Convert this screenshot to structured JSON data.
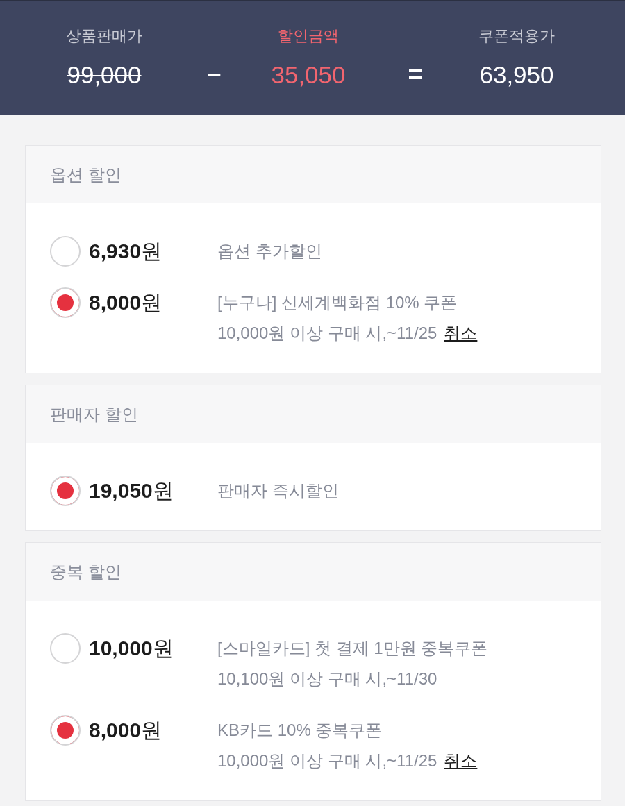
{
  "summary": {
    "original": {
      "label": "상품판매가",
      "value": "99,000"
    },
    "minus": "−",
    "discount": {
      "label": "할인금액",
      "value": "35,050"
    },
    "equals": "=",
    "final": {
      "label": "쿠폰적용가",
      "value": "63,950"
    }
  },
  "sections": [
    {
      "title": "옵션 할인",
      "options": [
        {
          "amount": "**6,930**원",
          "name": "옵션 추가할인",
          "selected": false
        },
        {
          "amount": "**8,000**원",
          "name": "[누구나] 신세계백화점 10% 쿠폰",
          "condition": "10,000원 이상 구매 시,~11/25",
          "cancel": "취소",
          "selected": true
        }
      ]
    },
    {
      "title": "판매자 할인",
      "options": [
        {
          "amount": "**19,050**원",
          "name": "판매자 즉시할인",
          "selected": true
        }
      ]
    },
    {
      "title": "중복 할인",
      "options": [
        {
          "amount": "**10,000**원",
          "name": "[스마일카드] 첫 결제 1만원 중복쿠폰",
          "condition": "10,100원 이상 구매 시,~11/30",
          "selected": false
        },
        {
          "amount": "**8,000**원",
          "name": "KB카드 10% 중복쿠폰",
          "condition": "10,000원 이상 구매 시,~11/25",
          "cancel": "취소",
          "selected": true
        }
      ]
    }
  ]
}
